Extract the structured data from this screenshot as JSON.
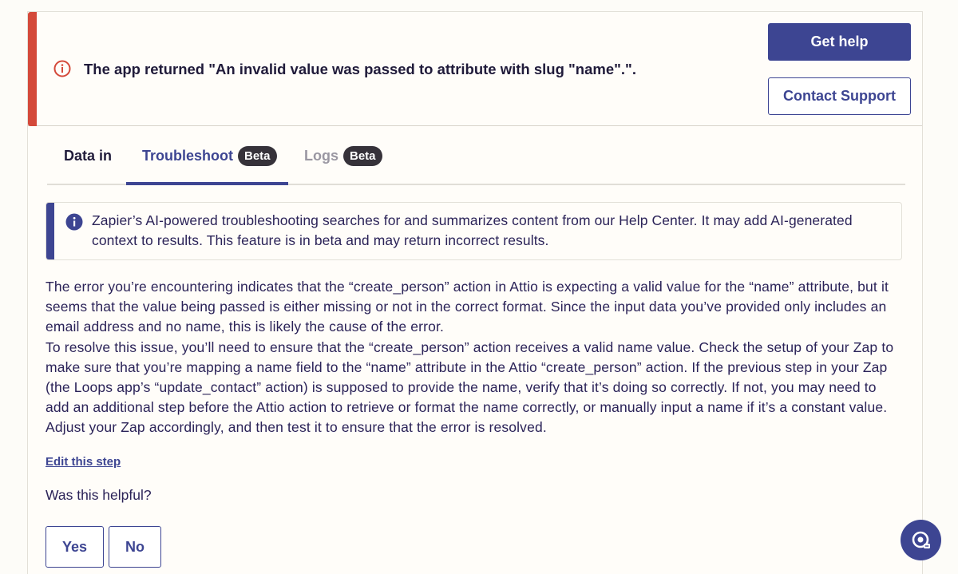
{
  "error": {
    "message": "The app returned \"An invalid value was passed to attribute with slug \"name\".\".",
    "icon": "alert-circle-icon",
    "accent_color": "#d4493a"
  },
  "actions": {
    "get_help": "Get help",
    "contact_support": "Contact Support"
  },
  "tabs": [
    {
      "label": "Data in",
      "badge": ""
    },
    {
      "label": "Troubleshoot",
      "badge": "Beta",
      "active": true
    },
    {
      "label": "Logs",
      "badge": "Beta"
    }
  ],
  "notice": {
    "icon": "info-icon",
    "text": "Zapier’s AI-powered troubleshooting searches for and summarizes content from our Help Center. It may add AI-generated context to results. This feature is in beta and may return incorrect results."
  },
  "answer": {
    "paragraph_1": "The error you’re encountering indicates that the “create_person” action in Attio is expecting a valid value for the “name” attribute, but it seems that the value being passed is either missing or not in the correct format. Since the input data you’ve provided only includes an email address and no name, this is likely the cause of the error.",
    "paragraph_2": "To resolve this issue, you’ll need to ensure that the “create_person” action receives a valid name value. Check the setup of your Zap to make sure that you’re mapping a name field to the “name” attribute in the Attio “create_person” action. If the previous step in your Zap (the Loops app’s “update_contact” action) is supposed to provide the name, verify that it’s doing so correctly. If not, you may need to add an additional step before the Attio action to retrieve or format the name correctly, or manually input a name if it’s a constant value. Adjust your Zap accordingly, and then test it to ensure that the error is resolved."
  },
  "edit_link": "Edit this step",
  "feedback": {
    "question": "Was this helpful?",
    "yes": "Yes",
    "no": "No"
  },
  "help_widget": {
    "icon": "help-chat-icon"
  },
  "colors": {
    "brand": "#3d4592",
    "error": "#d4493a",
    "badge_bg": "#36323a",
    "background": "#fdfcf8"
  }
}
